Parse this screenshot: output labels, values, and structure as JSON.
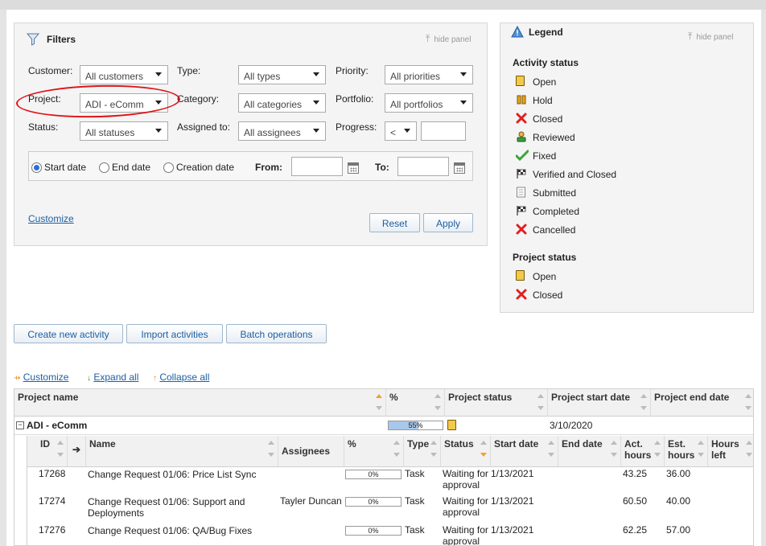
{
  "filters": {
    "title": "Filters",
    "hide_panel": "hide panel",
    "customer": {
      "label": "Customer:",
      "value": "All customers"
    },
    "type": {
      "label": "Type:",
      "value": "All types"
    },
    "priority": {
      "label": "Priority:",
      "value": "All priorities"
    },
    "project": {
      "label": "Project:",
      "value": "ADI - eComm"
    },
    "category": {
      "label": "Category:",
      "value": "All categories"
    },
    "portfolio": {
      "label": "Portfolio:",
      "value": "All portfolios"
    },
    "status": {
      "label": "Status:",
      "value": "All statuses"
    },
    "assigned": {
      "label": "Assigned to:",
      "value": "All assignees"
    },
    "progress": {
      "label": "Progress:",
      "operator": "<",
      "value": ""
    },
    "dates": {
      "start_date": "Start date",
      "end_date": "End date",
      "creation_date": "Creation date",
      "selected": "start_date",
      "from_label": "From:",
      "from_value": "",
      "to_label": "To:",
      "to_value": ""
    },
    "customize": "Customize",
    "reset": "Reset",
    "apply": "Apply"
  },
  "legend": {
    "title": "Legend",
    "hide_panel": "hide panel",
    "activity_status_title": "Activity status",
    "activity_status": [
      {
        "label": "Open",
        "icon": "open-folder-icon"
      },
      {
        "label": "Hold",
        "icon": "hold-icon"
      },
      {
        "label": "Closed",
        "icon": "red-x-icon"
      },
      {
        "label": "Reviewed",
        "icon": "reviewer-icon"
      },
      {
        "label": "Fixed",
        "icon": "checkmark-icon"
      },
      {
        "label": "Verified and Closed",
        "icon": "checkered-flag-icon"
      },
      {
        "label": "Submitted",
        "icon": "document-icon"
      },
      {
        "label": "Completed",
        "icon": "checkered-flag-icon"
      },
      {
        "label": "Cancelled",
        "icon": "red-x-icon"
      }
    ],
    "project_status_title": "Project status",
    "project_status": [
      {
        "label": "Open",
        "icon": "open-folder-icon"
      },
      {
        "label": "Closed",
        "icon": "red-x-icon"
      }
    ]
  },
  "actions": {
    "create": "Create new activity",
    "import": "Import activities",
    "batch": "Batch operations"
  },
  "tree_tools": {
    "customize": "Customize",
    "expand": "Expand all",
    "collapse": "Collapse all"
  },
  "grid": {
    "project_columns": [
      "Project name",
      "%",
      "Project status",
      "Project start date",
      "Project end date"
    ],
    "project_row": {
      "name": "ADI - eComm",
      "percent": 55,
      "percent_label": "55%",
      "status_icon": "open-folder-icon",
      "start_date": "3/10/2020",
      "end_date": ""
    },
    "activity_columns": [
      "ID",
      "Name",
      "Assignees",
      "%",
      "Type",
      "Status",
      "Start date",
      "End date",
      "Act.",
      "hours",
      "Est.",
      "hours",
      "Hours",
      "left"
    ],
    "activities": [
      {
        "id": "17268",
        "name": "Change Request 01/06: Price List Sync",
        "name2": "",
        "assignees": "",
        "percent": 0,
        "percent_label": "0%",
        "type": "Task",
        "status": "Waiting for",
        "status2": "approval",
        "start_date": "1/13/2021",
        "end_date": "",
        "act_hours": "43.25",
        "est_hours": "36.00",
        "hours_left": ""
      },
      {
        "id": "17274",
        "name": "Change Request 01/06: Support and",
        "name2": "Deployments",
        "assignees": "Tayler Duncan",
        "percent": 0,
        "percent_label": "0%",
        "type": "Task",
        "status": "Waiting for",
        "status2": "approval",
        "start_date": "1/13/2021",
        "end_date": "",
        "act_hours": "60.50",
        "est_hours": "40.00",
        "hours_left": ""
      },
      {
        "id": "17276",
        "name": "Change Request 01/06: QA/Bug Fixes",
        "name2": "",
        "assignees": "",
        "percent": 0,
        "percent_label": "0%",
        "type": "Task",
        "status": "Waiting for",
        "status2": "approval",
        "start_date": "1/13/2021",
        "end_date": "",
        "act_hours": "62.25",
        "est_hours": "57.00",
        "hours_left": ""
      }
    ]
  }
}
